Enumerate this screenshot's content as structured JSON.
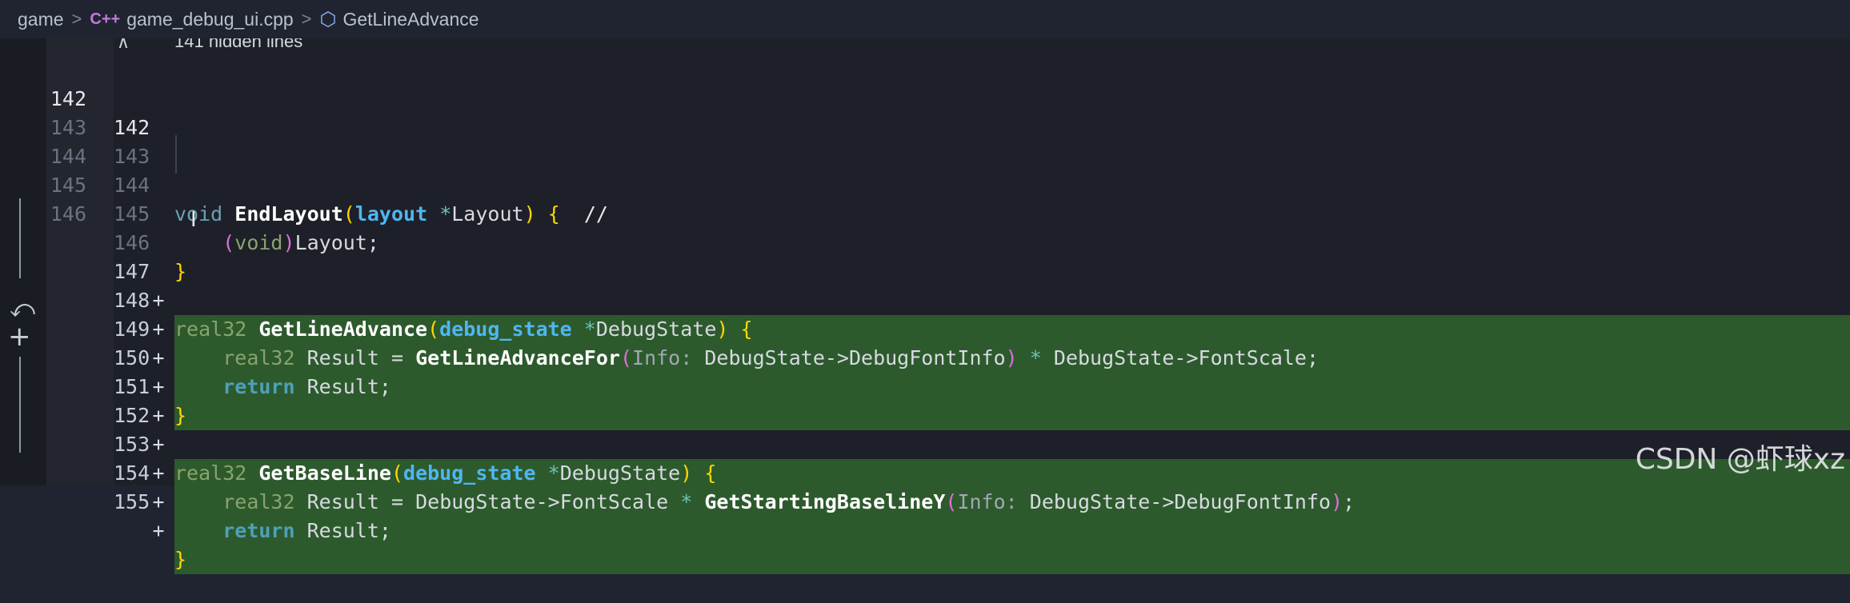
{
  "breadcrumb": {
    "root": "game",
    "file_icon": "C++",
    "file": "game_debug_ui.cpp",
    "symbol": "GetLineAdvance"
  },
  "hidden_lines": "141 hidden lines",
  "lines": [
    {
      "old": "142",
      "new": "142",
      "marker": "",
      "code": ""
    },
    {
      "old": "143",
      "new": "143",
      "marker": "",
      "code": "void EndLayout(layout *Layout) {  //"
    },
    {
      "old": "144",
      "new": "144",
      "marker": "",
      "code": "    (void)Layout;"
    },
    {
      "old": "145",
      "new": "145",
      "marker": "",
      "code": "}"
    },
    {
      "old": "146",
      "new": "146",
      "marker": "",
      "code": ""
    },
    {
      "old": "",
      "new": "147",
      "marker": "+",
      "code": "real32 GetLineAdvance(debug_state *DebugState) {"
    },
    {
      "old": "",
      "new": "148",
      "marker": "+",
      "code": "    real32 Result = GetLineAdvanceFor(Info: DebugState->DebugFontInfo) * DebugState->FontScale;"
    },
    {
      "old": "",
      "new": "149",
      "marker": "+",
      "code": "    return Result;"
    },
    {
      "old": "",
      "new": "150",
      "marker": "+",
      "code": "}"
    },
    {
      "old": "",
      "new": "151",
      "marker": "+",
      "code": ""
    },
    {
      "old": "",
      "new": "152",
      "marker": "+",
      "code": "real32 GetBaseLine(debug_state *DebugState) {"
    },
    {
      "old": "",
      "new": "153",
      "marker": "+",
      "code": "    real32 Result = DebugState->FontScale * GetStartingBaselineY(Info: DebugState->DebugFontInfo);"
    },
    {
      "old": "",
      "new": "154",
      "marker": "+",
      "code": "    return Result;"
    },
    {
      "old": "",
      "new": "155",
      "marker": "+",
      "code": "}"
    }
  ],
  "tokens": {
    "void": "void",
    "end_layout": "EndLayout",
    "layout_type": "layout",
    "star": "*",
    "layout_param": "Layout",
    "comment": "//",
    "real32": "real32",
    "get_line_advance": "GetLineAdvance",
    "debug_state_type": "debug_state",
    "debug_state_param": "DebugState",
    "result": "Result",
    "eq": "=",
    "get_line_advance_for": "GetLineAdvanceFor",
    "info_hint": "Info:",
    "debug_font_info": "DebugState->DebugFontInfo",
    "font_scale": "DebugState->FontScale",
    "return": "return",
    "get_base_line": "GetBaseLine",
    "get_starting_baseline_y": "GetStartingBaselineY"
  },
  "watermark": "CSDN @虾球xz",
  "colors": {
    "added_bg": "#2d5a2d",
    "editor_bg": "#1e2029",
    "function": "#ffffff",
    "type": "#4fb6f0",
    "keyword": "#6a9fb5",
    "bracket": "#ffd700"
  }
}
